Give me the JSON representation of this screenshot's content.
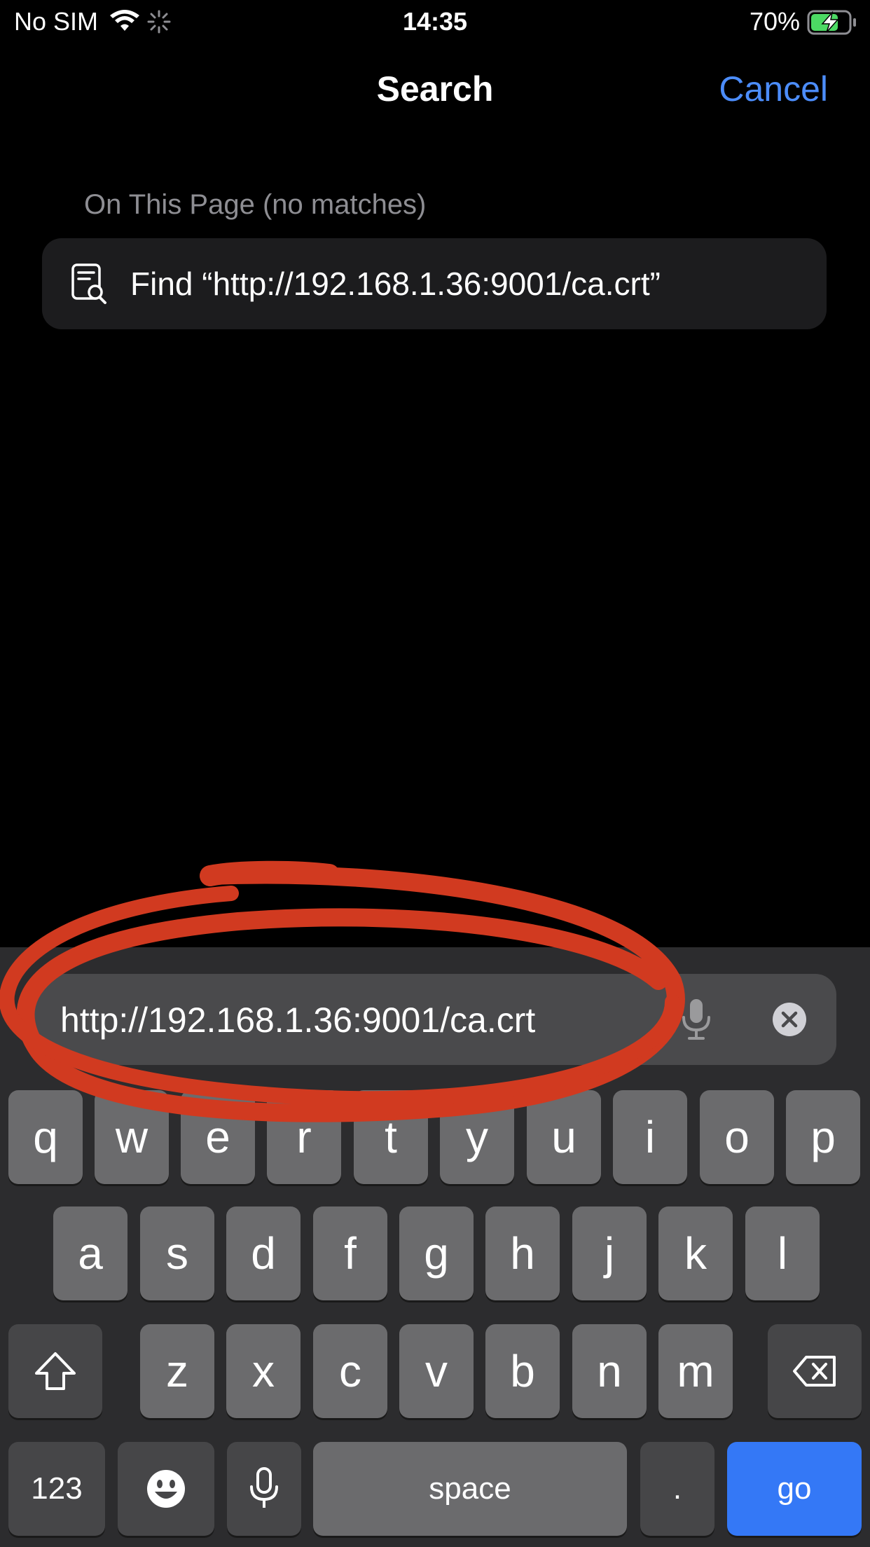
{
  "status_bar": {
    "carrier": "No SIM",
    "time": "14:35",
    "battery_percent": "70%"
  },
  "nav": {
    "title": "Search",
    "cancel_label": "Cancel"
  },
  "results": {
    "section_header": "On This Page (no matches)",
    "find_label": "Find “http://192.168.1.36:9001/ca.crt”"
  },
  "search_field": {
    "value": "http://192.168.1.36:9001/ca.crt"
  },
  "keyboard": {
    "row1": [
      "q",
      "w",
      "e",
      "r",
      "t",
      "y",
      "u",
      "i",
      "o",
      "p"
    ],
    "row2": [
      "a",
      "s",
      "d",
      "f",
      "g",
      "h",
      "j",
      "k",
      "l"
    ],
    "row3": [
      "z",
      "x",
      "c",
      "v",
      "b",
      "n",
      "m"
    ],
    "numbers_label": "123",
    "space_label": "space",
    "period_label": ".",
    "go_label": "go"
  },
  "colors": {
    "accent": "#4c8dfb",
    "go_key": "#3478f6",
    "annotation": "#d13a20",
    "battery_fill": "#4cd964"
  }
}
